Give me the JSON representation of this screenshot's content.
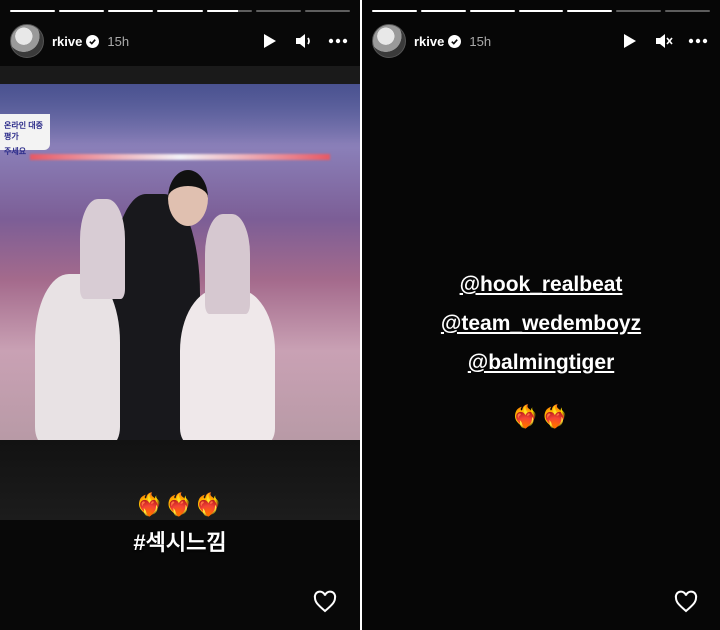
{
  "left_story": {
    "progress": [
      1,
      1,
      1,
      1,
      0.7,
      0,
      0
    ],
    "user": {
      "username": "rkive",
      "verified": true,
      "time": "15h",
      "avatar_icon": "avatar-image"
    },
    "controls": {
      "play_icon": "play-icon",
      "sound_icon": "volume-icon",
      "more_icon": "more-icon"
    },
    "caption": {
      "emoji": "❤️‍🔥❤️‍🔥❤️‍🔥",
      "hashtag": "#섹시느낌"
    },
    "like_icon": "heart-icon",
    "screen_overlay": {
      "line1": "온라인 대중 평가",
      "line2": "주세요"
    }
  },
  "right_story": {
    "progress": [
      1,
      1,
      1,
      1,
      1,
      0,
      0
    ],
    "user": {
      "username": "rkive",
      "verified": true,
      "time": "15h",
      "avatar_icon": "avatar-image"
    },
    "controls": {
      "play_icon": "play-icon",
      "sound_icon": "mute-icon",
      "more_icon": "more-icon"
    },
    "mentions": [
      "@hook_realbeat",
      "@team_wedemboyz",
      "@balmingtiger"
    ],
    "emoji": "❤️‍🔥❤️‍🔥",
    "like_icon": "heart-icon"
  },
  "colors": {
    "background": "#0a0a0a",
    "text": "#ffffff",
    "progress_track": "rgba(255,255,255,0.35)"
  }
}
